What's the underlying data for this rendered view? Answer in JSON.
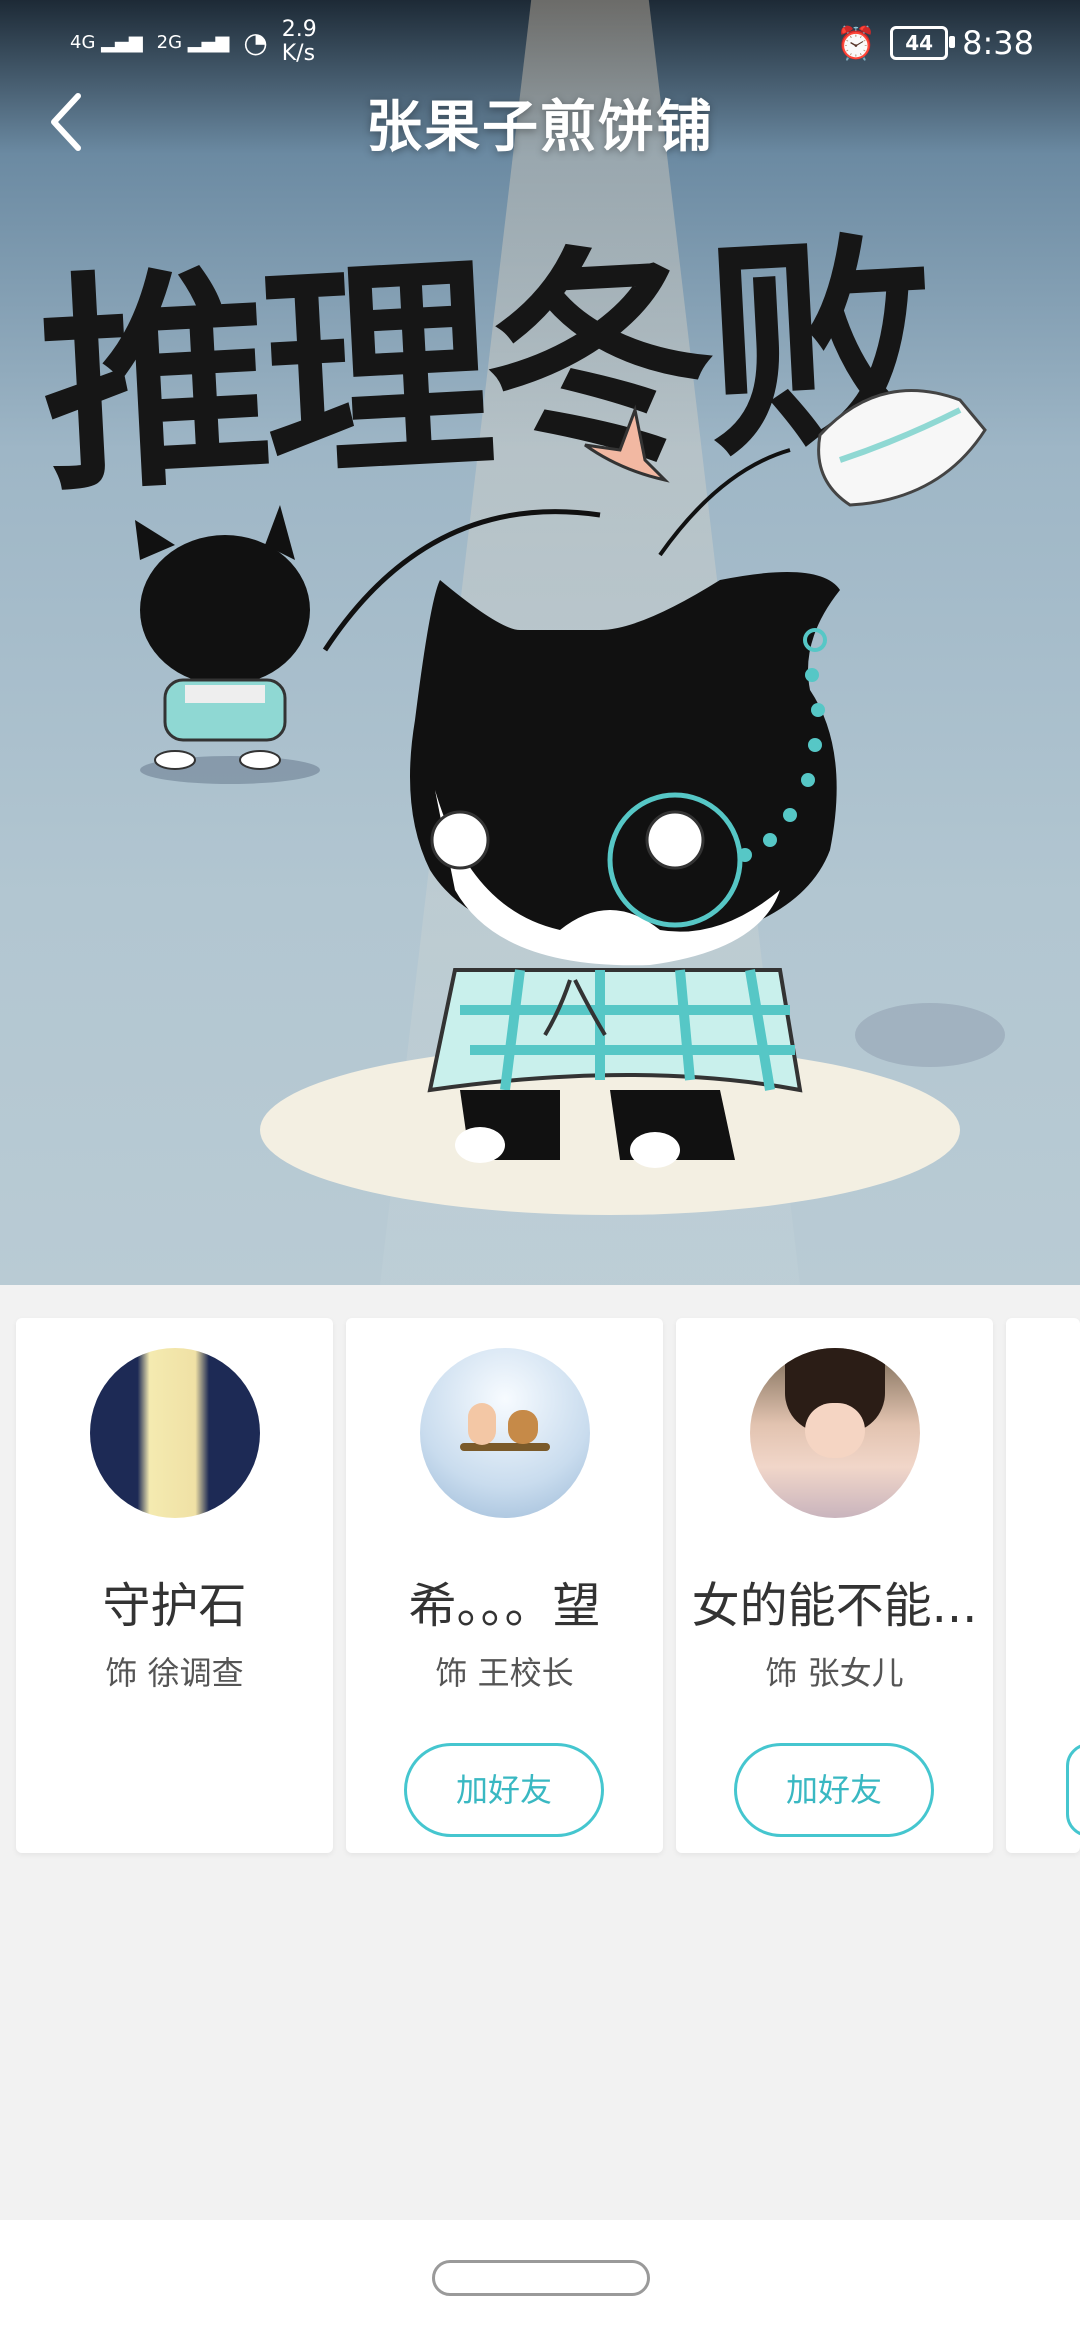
{
  "status_bar": {
    "net_speed_value": "2.9",
    "net_speed_unit": "K/s",
    "battery": "44",
    "time": "8:38",
    "signal_labels": [
      "4G",
      "2G"
    ]
  },
  "header": {
    "title": "张果子煎饼铺"
  },
  "poster": {
    "text": "推理冬败"
  },
  "cast": [
    {
      "name": "守护石",
      "role": "饰 徐调查",
      "has_add_button": false
    },
    {
      "name": "希。。。望",
      "role": "饰 王校长",
      "add_label": "加好友",
      "has_add_button": true
    },
    {
      "name": "女的能不能...",
      "role": "饰 张女儿",
      "add_label": "加好友",
      "has_add_button": true
    }
  ],
  "colors": {
    "accent": "#45c6cf"
  }
}
